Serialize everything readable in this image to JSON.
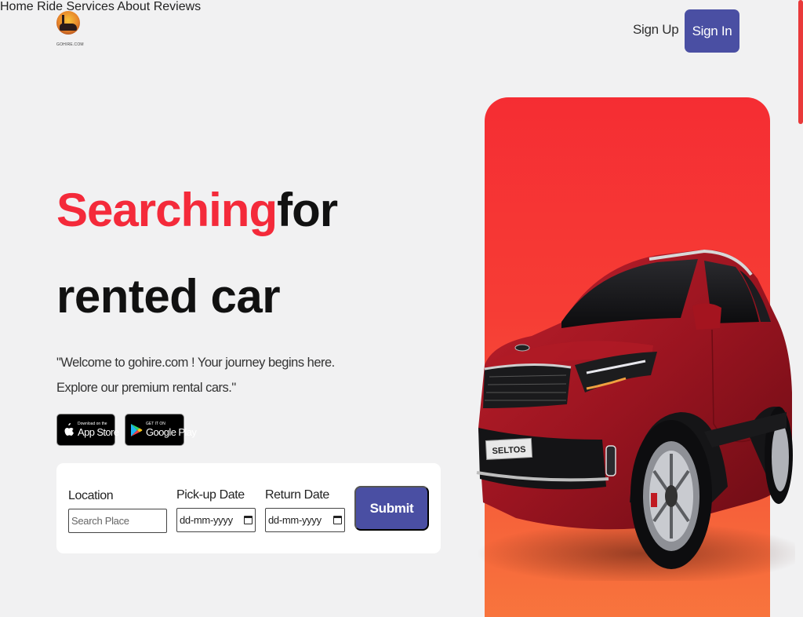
{
  "brand": {
    "logo_caption": "GOHIRE.COM"
  },
  "nav": {
    "items": [
      {
        "label": "Home"
      },
      {
        "label": "Ride"
      },
      {
        "label": "Services"
      },
      {
        "label": "About"
      },
      {
        "label": "Reviews"
      }
    ],
    "signup_label": "Sign Up",
    "signin_label": "Sign In"
  },
  "hero": {
    "headline_accent": "Searching",
    "headline_rest": "for",
    "headline_line2": "rented car",
    "tagline": "\"Welcome to gohire.com ! Your journey begins here. Explore our premium rental cars.\""
  },
  "badges": {
    "app_store": {
      "small": "Download on the",
      "big": "App Store"
    },
    "google_play": {
      "small": "GET IT ON",
      "big": "Google Play"
    }
  },
  "booking": {
    "location_label": "Location",
    "location_placeholder": "Search Place",
    "pickup_label": "Pick-up Date",
    "pickup_value": "dd-mm-yyyy",
    "return_label": "Return Date",
    "return_value": "dd-mm-yyyy",
    "submit_label": "Submit"
  },
  "car": {
    "plate": "SELTOS"
  },
  "colors": {
    "accent": "#f42a3a",
    "primary": "#4a4fa3",
    "panel": "#f63d35"
  }
}
